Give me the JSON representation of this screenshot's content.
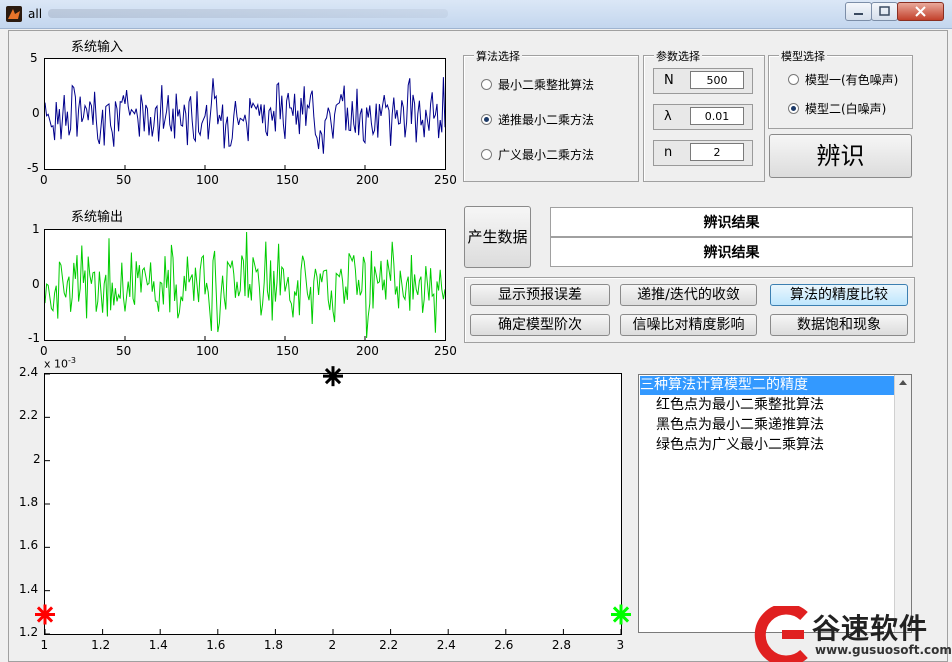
{
  "window": {
    "title": "all",
    "title_blurred": "…"
  },
  "input_plot": {
    "title": "系统输入",
    "y_ticks": [
      "5",
      "0",
      "-5"
    ],
    "x_ticks": [
      "0",
      "50",
      "100",
      "150",
      "200",
      "250"
    ],
    "line_color": "#00008b"
  },
  "output_plot": {
    "title": "系统输出",
    "y_ticks": [
      "1",
      "0",
      "-1"
    ],
    "x_ticks": [
      "0",
      "50",
      "100",
      "150",
      "200",
      "250"
    ],
    "line_color": "#00cc00"
  },
  "algorithm_group": {
    "title": "算法选择",
    "options": [
      {
        "label": "最小二乘整批算法",
        "selected": false
      },
      {
        "label": "递推最小二乘方法",
        "selected": true
      },
      {
        "label": "广义最小二乘方法",
        "selected": false
      }
    ]
  },
  "param_group": {
    "title": "参数选择",
    "params": [
      {
        "label": "N",
        "value": "500"
      },
      {
        "label": "λ",
        "value": "0.01"
      },
      {
        "label": "n",
        "value": "2"
      }
    ]
  },
  "model_group": {
    "title": "模型选择",
    "options": [
      {
        "label": "模型一(有色噪声)",
        "selected": false
      },
      {
        "label": "模型二(白噪声)",
        "selected": true
      }
    ]
  },
  "identify_button": "辨识",
  "generate_button": "产生数据",
  "results": [
    "辨识结果",
    "辨识结果"
  ],
  "action_buttons": [
    "显示预报误差",
    "递推/迭代的收敛",
    "算法的精度比较",
    "确定模型阶次",
    "信噪比对精度影响",
    "数据饱和现象"
  ],
  "listbox": {
    "items": [
      "三种算法计算模型二的精度",
      "红色点为最小二乘整批算法",
      "黑色点为最小二乘递推算法",
      "绿色点为广义最小二乘算法"
    ],
    "selected_index": 0
  },
  "chart_data": {
    "type": "scatter",
    "y_exponent_label": "x 10",
    "y_exponent_power": "-3",
    "x_ticks": [
      "1",
      "1.2",
      "1.4",
      "1.6",
      "1.8",
      "2",
      "2.2",
      "2.4",
      "2.6",
      "2.8",
      "3"
    ],
    "y_ticks": [
      "2.4",
      "2.2",
      "2",
      "1.8",
      "1.6",
      "1.4",
      "1.2"
    ],
    "xlim": [
      1,
      3
    ],
    "ylim": [
      1.2,
      2.4
    ],
    "grid": false,
    "series": [
      {
        "x": [
          1
        ],
        "y": [
          1.29
        ],
        "color": "#ff0000"
      },
      {
        "x": [
          2
        ],
        "y": [
          2.39
        ],
        "color": "#000000"
      },
      {
        "x": [
          3
        ],
        "y": [
          1.29
        ],
        "color": "#00ff00"
      }
    ]
  },
  "watermark": {
    "text": "谷速软件",
    "url": "www.gusuosoft.com"
  }
}
